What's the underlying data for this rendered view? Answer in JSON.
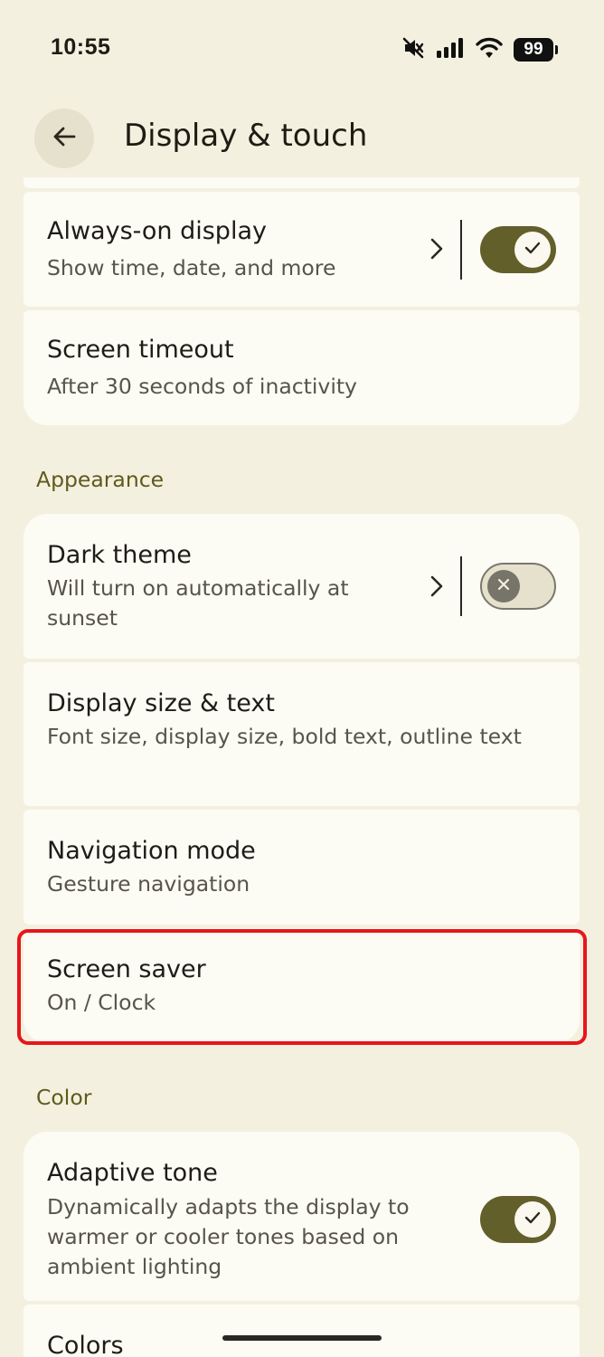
{
  "status_bar": {
    "time": "10:55",
    "battery": "99",
    "icons": [
      "mute-icon",
      "signal-icon",
      "wifi-icon",
      "battery-icon"
    ]
  },
  "header": {
    "title": "Display & touch",
    "back_icon": "back-arrow-icon"
  },
  "rows": {
    "always_on": {
      "title": "Always-on display",
      "subtitle": "Show time, date, and more",
      "toggle": "on"
    },
    "screen_timeout": {
      "title": "Screen timeout",
      "subtitle": "After 30 seconds of inactivity"
    },
    "dark_theme": {
      "title": "Dark theme",
      "subtitle": "Will turn on automatically at sunset",
      "toggle": "off"
    },
    "display_size": {
      "title": "Display size & text",
      "subtitle": "Font size, display size, bold text, outline text"
    },
    "navigation_mode": {
      "title": "Navigation mode",
      "subtitle": "Gesture navigation"
    },
    "screen_saver": {
      "title": "Screen saver",
      "subtitle": "On / Clock"
    },
    "adaptive_tone": {
      "title": "Adaptive tone",
      "subtitle": "Dynamically adapts the display to warmer or cooler tones based on ambient lighting",
      "toggle": "on"
    },
    "colors": {
      "title": "Colors"
    }
  },
  "sections": {
    "appearance": "Appearance",
    "color": "Color"
  },
  "colors": {
    "background": "#f4f0df",
    "card": "#fcfbf4",
    "accent": "#625f2b",
    "section_header": "#5e5a1c",
    "highlight": "#e8161b"
  }
}
